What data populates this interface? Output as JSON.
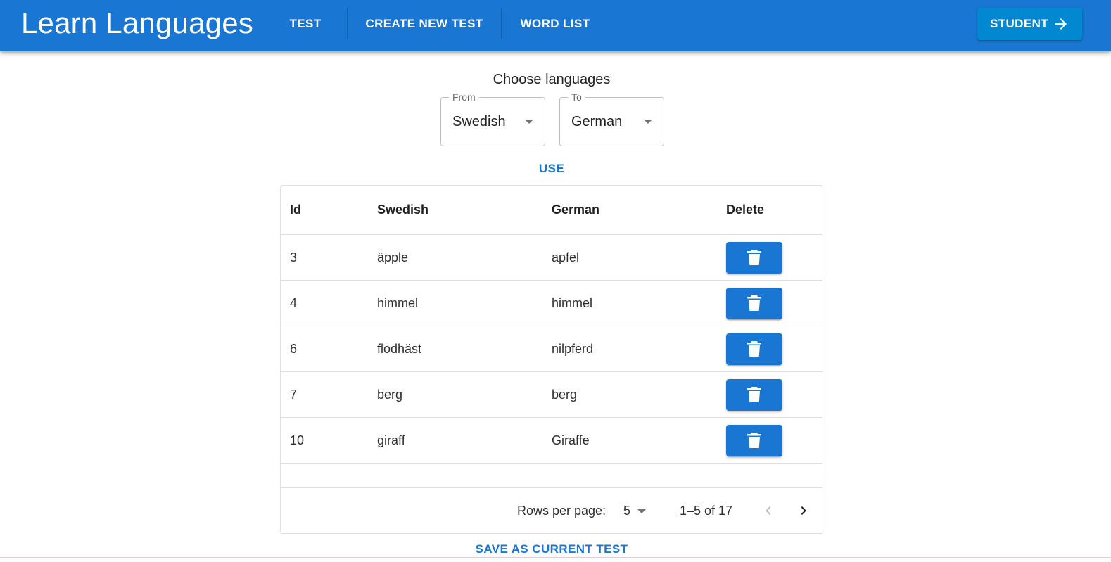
{
  "app": {
    "title": "Learn Languages",
    "primary_color": "#1976d2",
    "nav": [
      {
        "label": "TEST"
      },
      {
        "label": "CREATE NEW TEST"
      },
      {
        "label": "WORD LIST"
      }
    ],
    "user_button": {
      "label": "STUDENT",
      "icon": "arrow-right-icon"
    }
  },
  "language_chooser": {
    "title": "Choose languages",
    "from": {
      "label": "From",
      "value": "Swedish"
    },
    "to": {
      "label": "To",
      "value": "German"
    },
    "use_label": "USE"
  },
  "table": {
    "columns": [
      "Id",
      "Swedish",
      "German",
      "Delete"
    ],
    "rows": [
      {
        "id": "3",
        "from": "äpple",
        "to": "apfel"
      },
      {
        "id": "4",
        "from": "himmel",
        "to": "himmel"
      },
      {
        "id": "6",
        "from": "flodhäst",
        "to": "nilpferd"
      },
      {
        "id": "7",
        "from": "berg",
        "to": "berg"
      },
      {
        "id": "10",
        "from": "giraff",
        "to": "Giraffe"
      }
    ],
    "delete_icon": "trash-icon",
    "footer": {
      "rows_per_page_label": "Rows per page:",
      "rows_per_page_value": "5",
      "range_label": "1–5 of 17",
      "prev_icon": "chevron-left-icon",
      "next_icon": "chevron-right-icon"
    }
  },
  "save_label": "SAVE AS CURRENT TEST"
}
